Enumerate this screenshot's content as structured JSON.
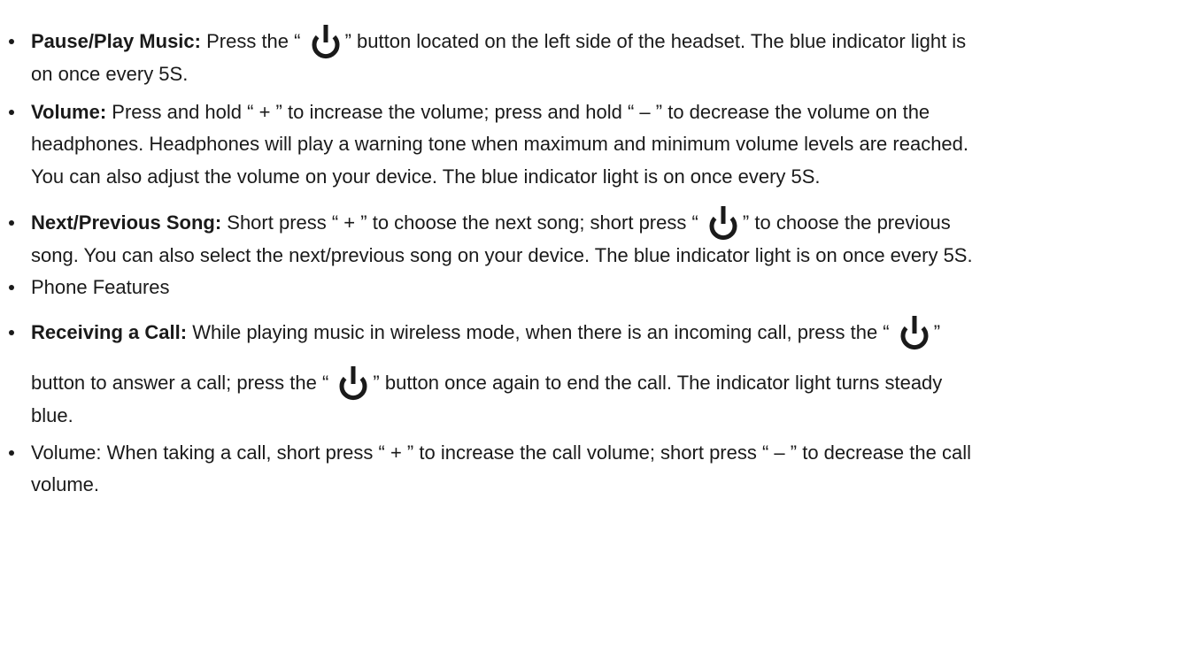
{
  "items": {
    "pause_play": {
      "lead": "Pause/Play Music:",
      "text_a": " Press the “ ",
      "text_b": "” button located on the left side of the headset. The blue indicator light is",
      "line2": "on once every 5S."
    },
    "volume": {
      "lead": "Volume:",
      "line1": " Press and hold “ + ” to increase the volume; press and hold “ – ” to decrease the volume on the",
      "line2": "headphones. Headphones will play a warning tone when maximum and minimum volume levels are reached.",
      "line3": "You can also adjust the volume on your device. The blue indicator light is on once every 5S."
    },
    "next_prev": {
      "lead": "Next/Previous Song:",
      "text_a": " Short press “ + ” to choose the next song; short press “ ",
      "text_b": "” to choose the previous",
      "line2": "song. You can also select the next/previous song on your device. The blue indicator light is on once every 5S."
    },
    "phone_features": {
      "text": "Phone Features"
    },
    "receiving_call": {
      "lead": "Receiving a Call:",
      "text_a": " While playing music in wireless mode, when there is an incoming call, press the “ ",
      "text_b": "”",
      "line2_a": "button to answer a call; press the “ ",
      "line2_b": "” button once again to end the call. The indicator light turns steady",
      "line3": "blue."
    },
    "call_volume": {
      "line1": "Volume: When taking a call, short press “ + ” to increase the call volume; short press “ – ” to decrease the call",
      "line2": "volume."
    }
  },
  "icons": {
    "power": "power-icon"
  }
}
